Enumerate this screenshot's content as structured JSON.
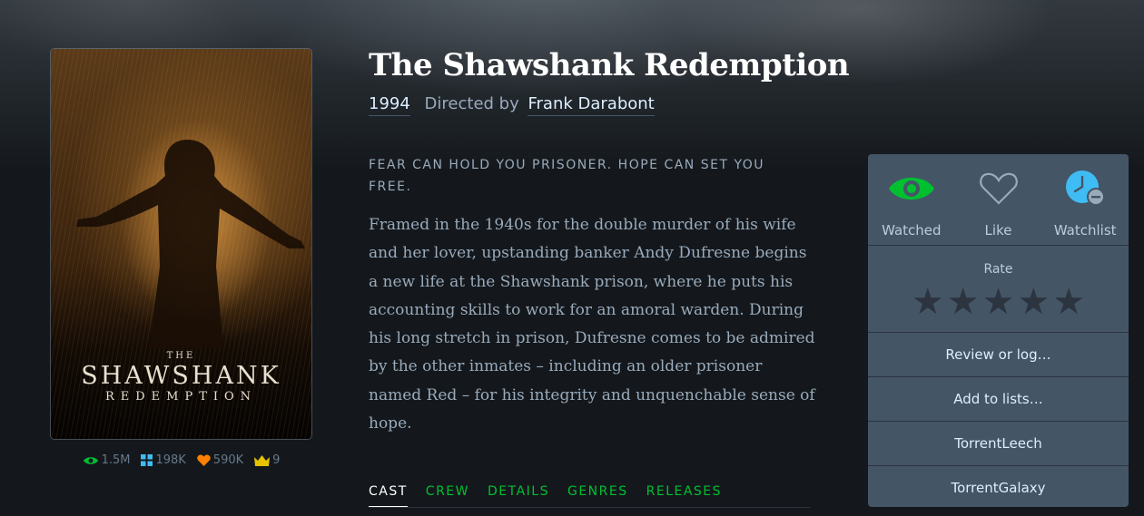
{
  "film": {
    "title": "The Shawshank Redemption",
    "year": "1994",
    "directed_by_label": "Directed by",
    "director": "Frank Darabont",
    "tagline": "FEAR CAN HOLD YOU PRISONER. HOPE CAN SET YOU FREE.",
    "synopsis": "Framed in the 1940s for the double murder of his wife and her lover, upstanding banker Andy Dufresne begins a new life at the Shawshank prison, where he puts his accounting skills to work for an amoral warden. During his long stretch in prison, Dufresne comes to be admired by the other inmates – including an older prisoner named Red – for his integrity and unquenchable sense of hope."
  },
  "poster": {
    "line1": "THE",
    "line2": "SHAWSHANK",
    "line3": "REDEMPTION"
  },
  "stats": {
    "watched": "1.5M",
    "lists": "198K",
    "likes": "590K",
    "top": "9",
    "icons": [
      "eye-icon",
      "grid-icon",
      "heart-icon",
      "crown-icon"
    ],
    "colors": {
      "eye": "#00c030",
      "grid": "#40bcf4",
      "heart": "#ff8000",
      "crown": "#e7c200"
    }
  },
  "tabs": [
    "CAST",
    "CREW",
    "DETAILS",
    "GENRES",
    "RELEASES"
  ],
  "active_tab": "CAST",
  "actions": {
    "watched_label": "Watched",
    "like_label": "Like",
    "watchlist_label": "Watchlist",
    "rate_label": "Rate",
    "rating": 0,
    "rating_max": 5,
    "review_label": "Review or log…",
    "lists_label": "Add to lists…",
    "link1": "TorrentLeech",
    "link2": "TorrentGalaxy"
  },
  "colors": {
    "accent_green": "#00c030",
    "watchlist_blue": "#40bcf4",
    "panel_bg": "#445566",
    "page_bg": "#14181c"
  }
}
